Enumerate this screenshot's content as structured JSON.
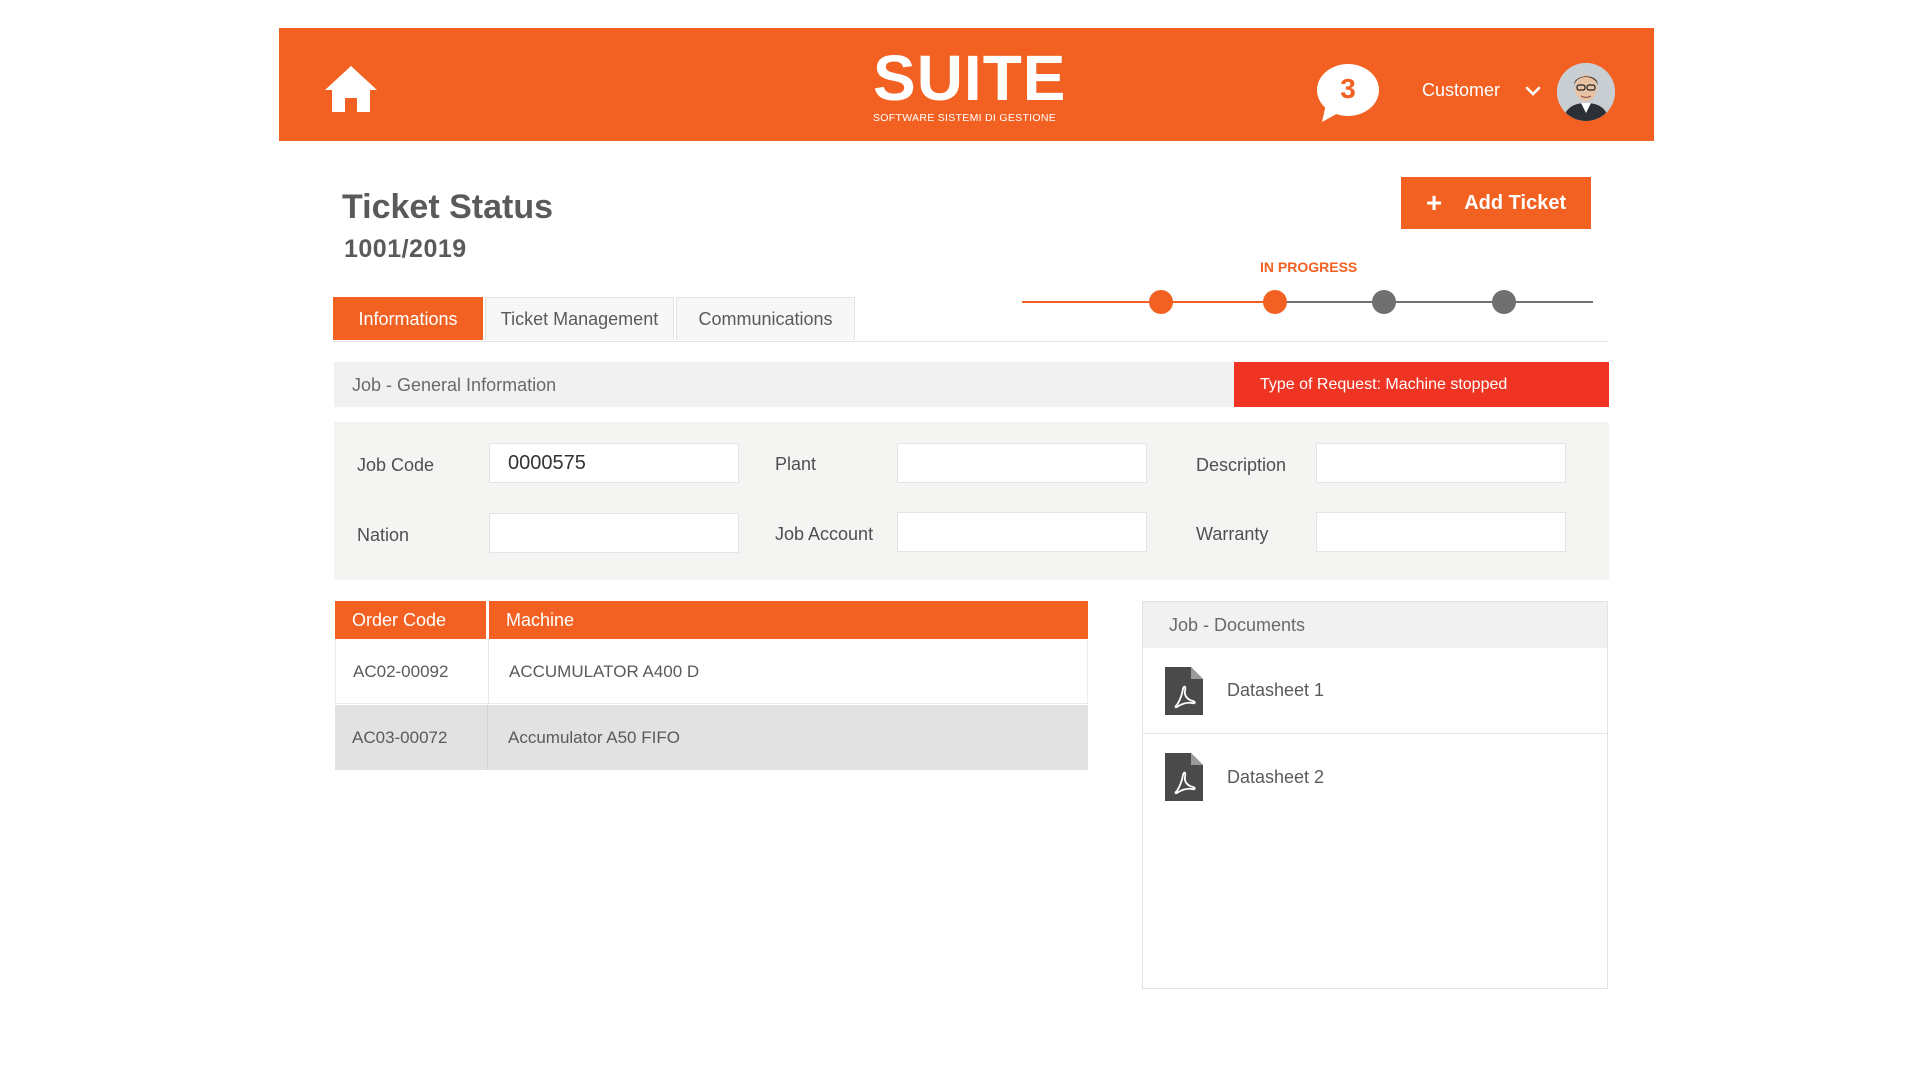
{
  "header": {
    "brand": "SUITE",
    "tagline": "SOFTWARE SISTEMI DI GESTIONE",
    "notification_count": "3",
    "user_label": "Customer"
  },
  "page": {
    "title": "Ticket Status",
    "ticket_number": "1001/2019",
    "add_ticket_label": "Add Ticket"
  },
  "progress": {
    "current_label": "IN PROGRESS",
    "total_steps": 4,
    "completed_steps": 2
  },
  "tabs": [
    {
      "label": "Informations",
      "active": true
    },
    {
      "label": "Ticket Management",
      "active": false
    },
    {
      "label": "Communications",
      "active": false
    }
  ],
  "section": {
    "title": "Job - General Information",
    "request_type": "Type of Request: Machine stopped"
  },
  "form": {
    "job_code_label": "Job Code",
    "job_code_value": "0000575",
    "plant_label": "Plant",
    "plant_value": "",
    "description_label": "Description",
    "description_value": "",
    "nation_label": "Nation",
    "nation_value": "",
    "job_account_label": "Job Account",
    "job_account_value": "",
    "warranty_label": "Warranty",
    "warranty_value": ""
  },
  "orders": {
    "headers": [
      "Order Code",
      "Machine"
    ],
    "rows": [
      {
        "code": "AC02-00092",
        "machine": "ACCUMULATOR A400 D"
      },
      {
        "code": "AC03-00072",
        "machine": "Accumulator A50 FIFO"
      }
    ]
  },
  "documents": {
    "title": "Job - Documents",
    "items": [
      {
        "name": "Datasheet 1",
        "icon": "pdf-icon"
      },
      {
        "name": "Datasheet 2",
        "icon": "pdf-icon"
      }
    ]
  },
  "colors": {
    "brand": "#f26122",
    "alert": "#ef3424",
    "step_inactive": "#707070"
  }
}
